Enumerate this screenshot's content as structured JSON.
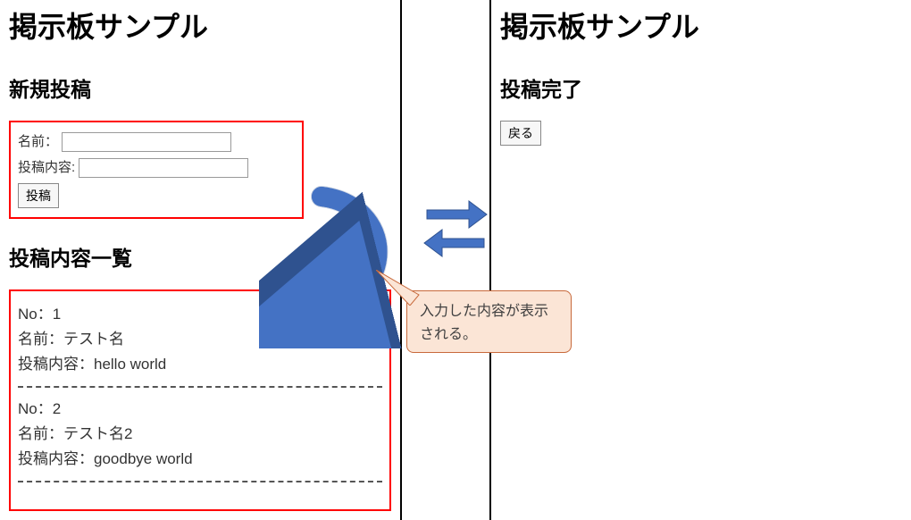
{
  "left": {
    "title": "掲示板サンプル",
    "newPostHeader": "新規投稿",
    "form": {
      "nameLabel": "名前：",
      "nameValue": "",
      "contentLabel": "投稿内容:",
      "contentValue": "",
      "submitLabel": "投稿"
    },
    "listHeader": "投稿内容一覧",
    "posts": [
      {
        "no": "No：1",
        "name": "名前：テスト名",
        "content": "投稿内容：hello world"
      },
      {
        "no": "No：2",
        "name": "名前：テスト名2",
        "content": "投稿内容：goodbye world"
      }
    ]
  },
  "right": {
    "title": "掲示板サンプル",
    "doneHeader": "投稿完了",
    "backLabel": "戻る"
  },
  "annotation": {
    "calloutLine1": "入力した内容が表示",
    "calloutLine2": "される。"
  }
}
